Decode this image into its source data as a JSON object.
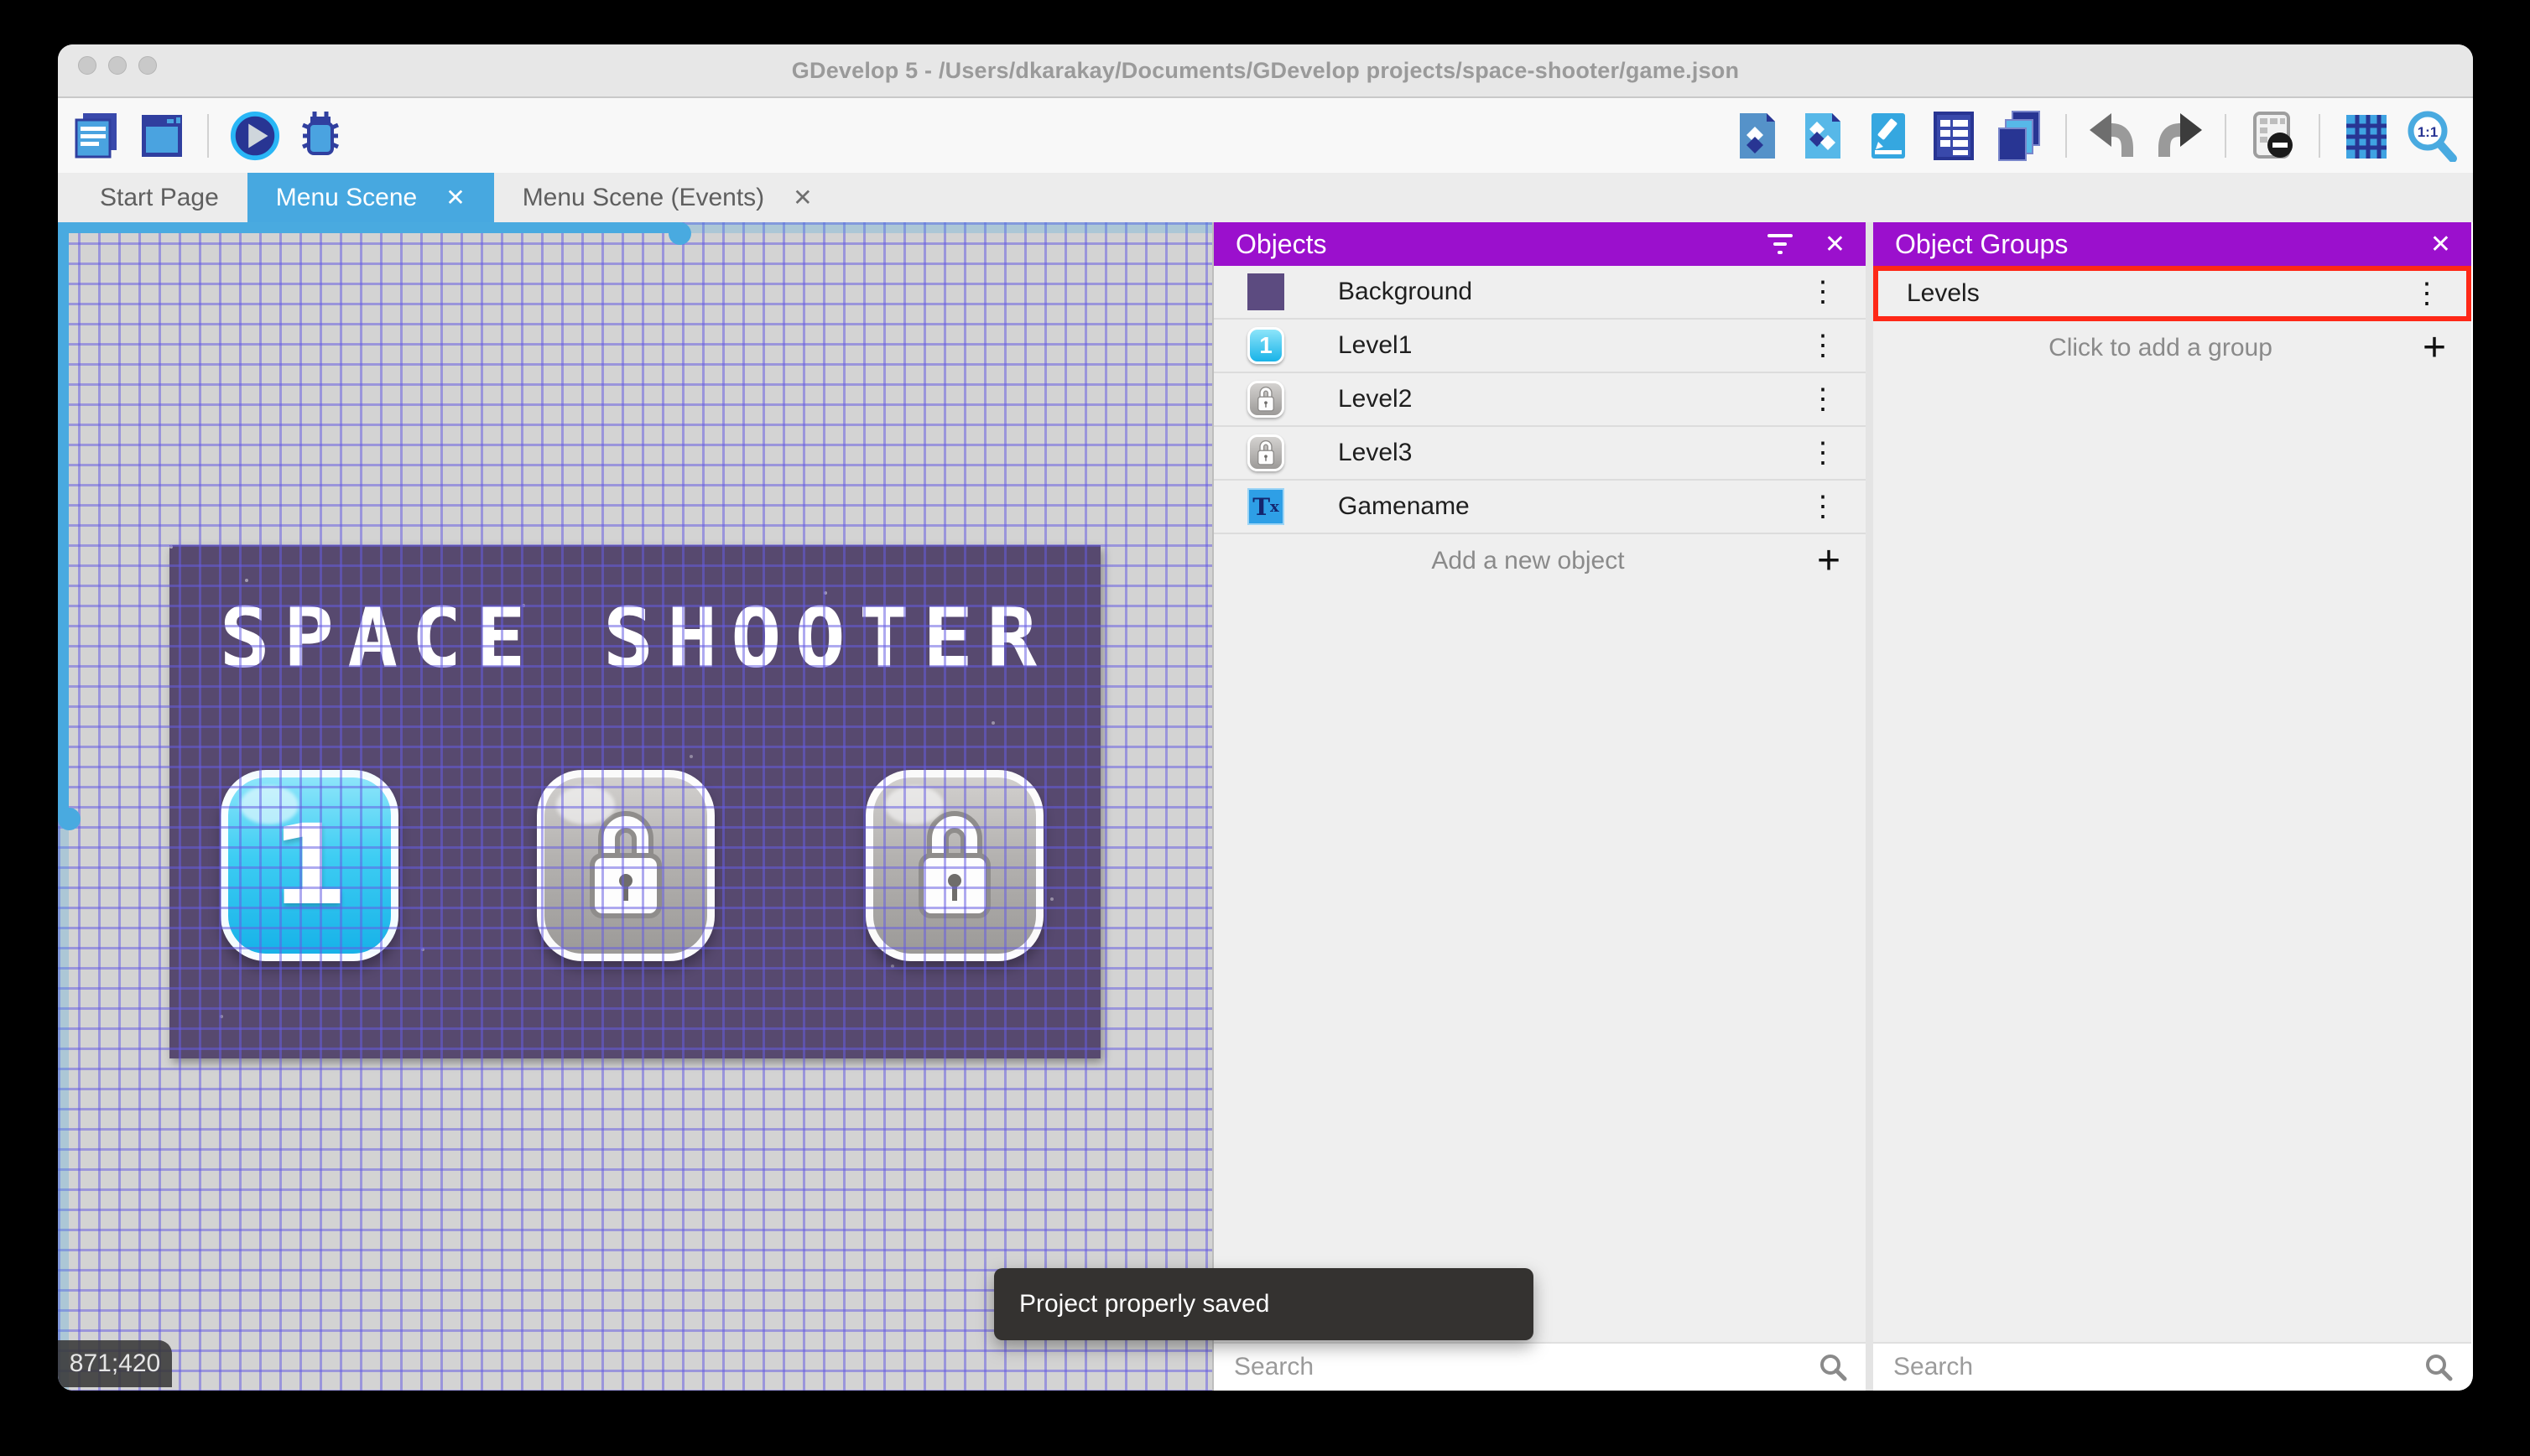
{
  "window": {
    "title": "GDevelop 5 - /Users/dkarakay/Documents/GDevelop projects/space-shooter/game.json"
  },
  "toolbar": {
    "zoom_ratio": "1:1",
    "left_icons": [
      "project-manager",
      "scene-editor",
      "preview-play",
      "debug"
    ],
    "right_icons": [
      "open-objects-panel",
      "open-object-groups-panel",
      "open-properties-panel",
      "open-instances-panel",
      "open-layers-panel",
      "undo",
      "redo",
      "toggle-instances-mask",
      "toggle-grid",
      "zoom-one-to-one"
    ]
  },
  "tabs": {
    "items": [
      {
        "label": "Start Page",
        "active": false,
        "closable": false
      },
      {
        "label": "Menu Scene",
        "active": true,
        "closable": true
      },
      {
        "label": "Menu Scene (Events)",
        "active": false,
        "closable": true
      }
    ]
  },
  "icons": {
    "kebab_glyph": "⋮",
    "plus_glyph": "+",
    "close_glyph": "✕"
  },
  "canvas": {
    "scene_title": "SPACE SHOOTER",
    "coordinates": "871;420",
    "level_buttons": [
      {
        "type": "unlocked",
        "label": "1"
      },
      {
        "type": "locked"
      },
      {
        "type": "locked"
      }
    ]
  },
  "objects_panel": {
    "title": "Objects",
    "items": [
      {
        "label": "Background",
        "thumb": "purple-square"
      },
      {
        "label": "Level1",
        "thumb": "blue-button",
        "thumb_text": "1"
      },
      {
        "label": "Level2",
        "thumb": "locked-button"
      },
      {
        "label": "Level3",
        "thumb": "locked-button"
      },
      {
        "label": "Gamename",
        "thumb": "text-object",
        "thumb_text": "T",
        "thumb_text_small": "x"
      }
    ],
    "add_label": "Add a new object",
    "search_placeholder": "Search"
  },
  "groups_panel": {
    "title": "Object Groups",
    "items": [
      {
        "label": "Levels"
      }
    ],
    "add_label": "Click to add a group",
    "search_placeholder": "Search",
    "highlight_color": "#fe2817"
  },
  "toast": {
    "message": "Project properly saved"
  },
  "colors": {
    "panel_header": "#9b10cd",
    "active_tab": "#47a8e0",
    "scene_background": "#57496f",
    "grid_line": "#655ce2",
    "highlight_red": "#fe2817",
    "accent_blue": "#49aae0"
  }
}
